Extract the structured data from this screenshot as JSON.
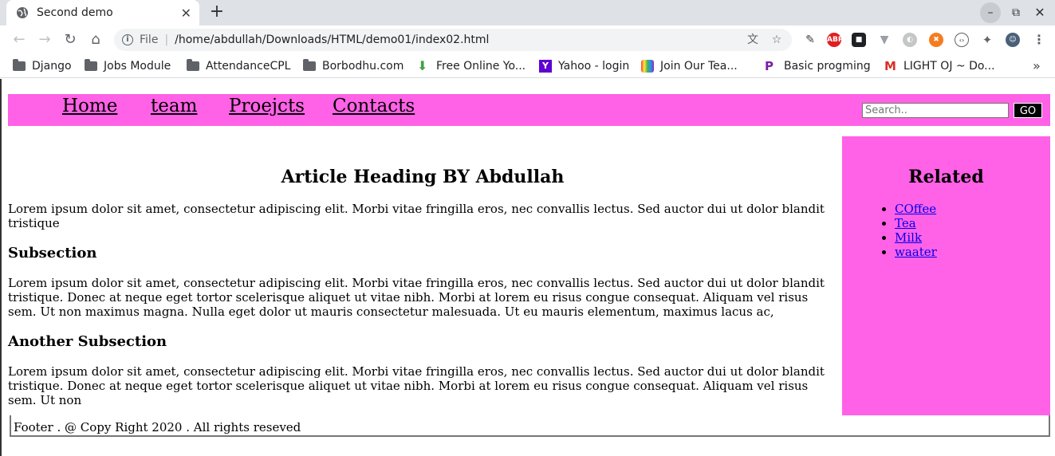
{
  "browser": {
    "tab_title": "Second demo",
    "url_scheme": "File",
    "url": "/home/abdullah/Downloads/HTML/demo01/index02.html",
    "bookmarks": [
      {
        "label": "Django",
        "icon": "folder-icon"
      },
      {
        "label": "Jobs Module",
        "icon": "folder-icon"
      },
      {
        "label": "AttendanceCPL",
        "icon": "folder-icon"
      },
      {
        "label": "Borbodhu.com",
        "icon": "folder-icon"
      },
      {
        "label": "Free Online Yo...",
        "icon": "download-arrow-icon"
      },
      {
        "label": "Yahoo - login",
        "icon": "yahoo-icon"
      },
      {
        "label": "Join Our Tea...",
        "icon": "rainbow-icon"
      },
      {
        "label": "Basic progming",
        "icon": "p-logo-icon"
      },
      {
        "label": "LIGHT OJ ~ Do...",
        "icon": "gmail-icon"
      }
    ],
    "extensions": {
      "abp": "ABP"
    }
  },
  "nav": {
    "links": [
      "Home",
      "team",
      "Proejcts",
      "Contacts"
    ],
    "search_placeholder": "Search..",
    "go_label": "GO"
  },
  "article": {
    "heading": "Article Heading BY Abdullah",
    "intro": "Lorem ipsum dolor sit amet, consectetur adipiscing elit. Morbi vitae fringilla eros, nec convallis lectus. Sed auctor dui ut dolor blandit tristique",
    "sub1_title": "Subsection",
    "sub1_text": "Lorem ipsum dolor sit amet, consectetur adipiscing elit. Morbi vitae fringilla eros, nec convallis lectus. Sed auctor dui ut dolor blandit tristique. Donec at neque eget tortor scelerisque aliquet ut vitae nibh. Morbi at lorem eu risus congue consequat. Aliquam vel risus sem. Ut non maximus magna. Nulla eget dolor ut mauris consectetur malesuada. Ut eu mauris elementum, maximus lacus ac,",
    "sub2_title": "Another Subsection",
    "sub2_text": "Lorem ipsum dolor sit amet, consectetur adipiscing elit. Morbi vitae fringilla eros, nec convallis lectus. Sed auctor dui ut dolor blandit tristique. Donec at neque eget tortor scelerisque aliquet ut vitae nibh. Morbi at lorem eu risus congue consequat. Aliquam vel risus sem. Ut non"
  },
  "aside": {
    "heading": "Related",
    "items": [
      "COffee",
      "Tea",
      "Milk",
      "waater"
    ]
  },
  "footer": {
    "text": "Footer . @ Copy Right 2020 . All rights reseved"
  },
  "colors": {
    "accent_pink": "#ff61e7",
    "link_blue": "#0000ee"
  }
}
